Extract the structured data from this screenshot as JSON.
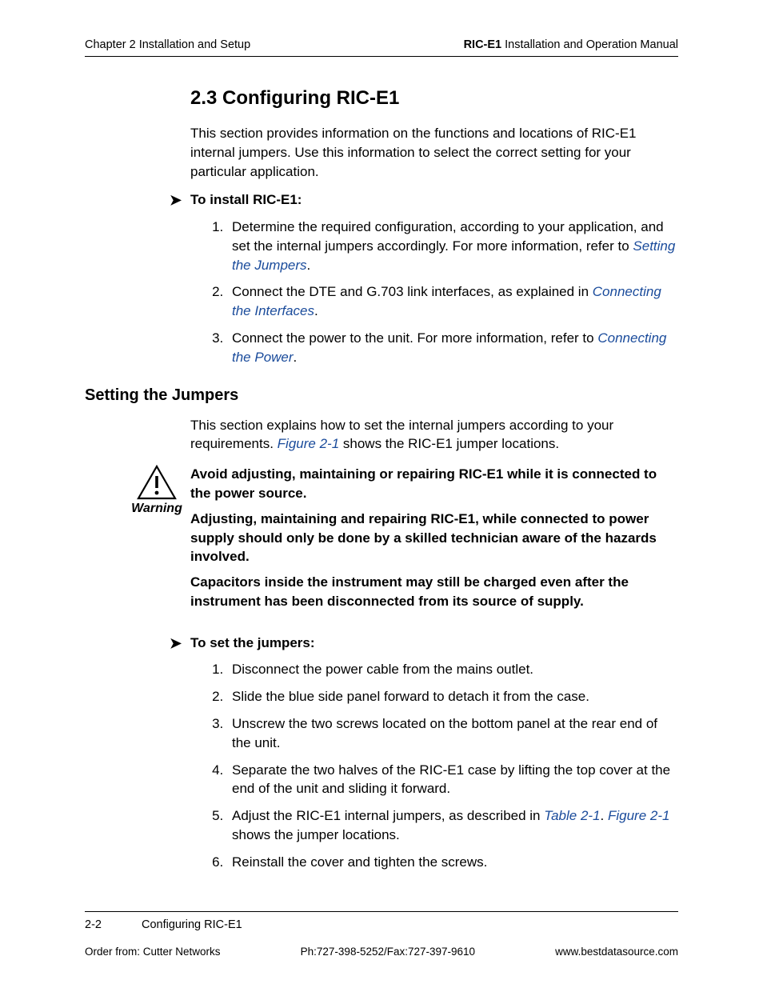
{
  "header": {
    "left": "Chapter 2  Installation and Setup",
    "right_bold": "RIC-E1",
    "right_rest": " Installation and Operation Manual"
  },
  "section": {
    "number_title": "2.3  Configuring RIC-E1",
    "intro": "This section provides information on the functions and locations of RIC-E1 internal jumpers. Use this information to select the correct setting for your particular application."
  },
  "proc1": {
    "title": "To install RIC-E1:",
    "steps": {
      "s1a": "Determine the required configuration, according to your application, and set the internal jumpers accordingly. For more information, refer to ",
      "s1link": "Setting the Jumpers",
      "s1b": ".",
      "s2a": "Connect the DTE and G.703 link interfaces, as explained in ",
      "s2link": "Connecting the Interfaces",
      "s2b": ".",
      "s3a": "Connect the power to the unit. For more information, refer to ",
      "s3link": "Connecting the Power",
      "s3b": "."
    }
  },
  "subhead": "Setting the Jumpers",
  "sub_intro_a": "This section explains how to set the internal jumpers according to your requirements. ",
  "sub_intro_link": "Figure 2-1",
  "sub_intro_b": " shows the RIC-E1 jumper locations.",
  "warning": {
    "label": "Warning",
    "p1": "Avoid adjusting, maintaining or repairing RIC-E1 while it is connected to the power source.",
    "p2": "Adjusting, maintaining and repairing RIC-E1, while connected to power supply should only be done by a skilled technician aware of the hazards involved.",
    "p3": "Capacitors inside the instrument may still be charged even after the instrument has been disconnected from its source of supply."
  },
  "proc2": {
    "title": "To set the jumpers:",
    "steps": {
      "s1": "Disconnect the power cable from the mains outlet.",
      "s2": "Slide the blue side panel forward to detach it from the case.",
      "s3": "Unscrew the two screws located on the bottom panel at the rear end of the unit.",
      "s4": "Separate the two halves of the RIC-E1 case by lifting the top cover at the end of the unit and sliding it forward.",
      "s5a": "Adjust the RIC-E1 internal jumpers, as described in ",
      "s5link1": "Table 2-1",
      "s5mid": ". ",
      "s5link2": "Figure 2-1",
      "s5b": " shows the jumper locations.",
      "s6": "Reinstall the cover and tighten the screws."
    }
  },
  "footer": {
    "page": "2-2",
    "title": "Configuring RIC-E1",
    "order": "Order from: Cutter Networks",
    "phone": "Ph:727-398-5252/Fax:727-397-9610",
    "url": "www.bestdatasource.com"
  }
}
